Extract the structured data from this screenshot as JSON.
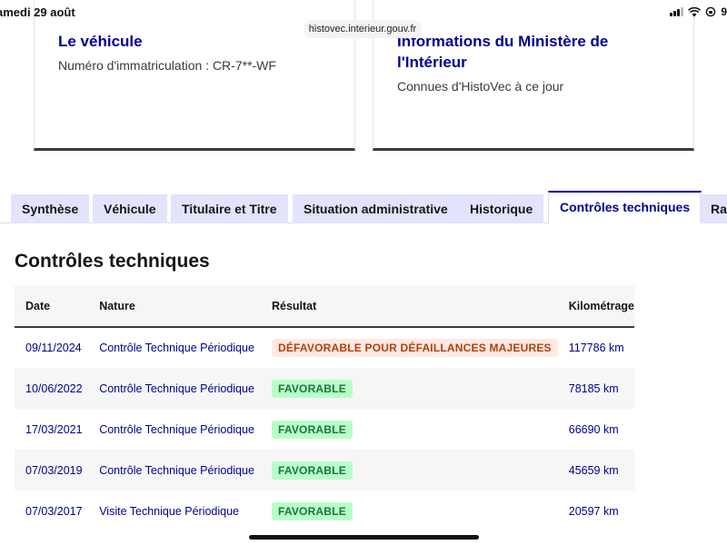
{
  "status_bar": {
    "time_date": "amedi 29 août",
    "battery": "9"
  },
  "browser": {
    "url": "histovec.interieur.gouv.fr"
  },
  "cards": {
    "vehicle": {
      "title": "Le véhicule",
      "description": "Numéro d'immatriculation : CR-7**-WF"
    },
    "ministry": {
      "title": "Informations du Ministère de l'Intérieur",
      "description": "Connues d'HistoVec à ce jour"
    }
  },
  "tabs": [
    {
      "label": "Synthèse"
    },
    {
      "label": "Véhicule"
    },
    {
      "label": "Titulaire et Titre"
    },
    {
      "label": "Situation administrative"
    },
    {
      "label": "Historique"
    },
    {
      "label": "Contrôles techniques"
    },
    {
      "label": "Rap"
    }
  ],
  "active_tab": "Contrôles techniques",
  "section": {
    "title": "Contrôles techniques"
  },
  "table": {
    "headers": [
      "Date",
      "Nature",
      "Résultat",
      "Kilométrage"
    ],
    "rows": [
      {
        "date": "09/11/2024",
        "nature": "Contrôle Technique Périodique",
        "result": "DÉFAVORABLE POUR DÉFAILLANCES MAJEURES",
        "result_status": "bad",
        "mileage": "117786 km"
      },
      {
        "date": "10/06/2022",
        "nature": "Contrôle Technique Périodique",
        "result": "FAVORABLE",
        "result_status": "good",
        "mileage": "78185 km"
      },
      {
        "date": "17/03/2021",
        "nature": "Contrôle Technique Périodique",
        "result": "FAVORABLE",
        "result_status": "good",
        "mileage": "66690 km"
      },
      {
        "date": "07/03/2019",
        "nature": "Contrôle Technique Périodique",
        "result": "FAVORABLE",
        "result_status": "good",
        "mileage": "45659 km"
      },
      {
        "date": "07/03/2017",
        "nature": "Visite Technique Périodique",
        "result": "FAVORABLE",
        "result_status": "good",
        "mileage": "20597 km"
      }
    ]
  },
  "colors": {
    "primary_blue": "#000091",
    "tab_bg": "#e3e3fd",
    "bad_bg": "#ffe9e6",
    "bad_text": "#b34000",
    "good_bg": "#b8fec9",
    "good_text": "#18753c"
  }
}
